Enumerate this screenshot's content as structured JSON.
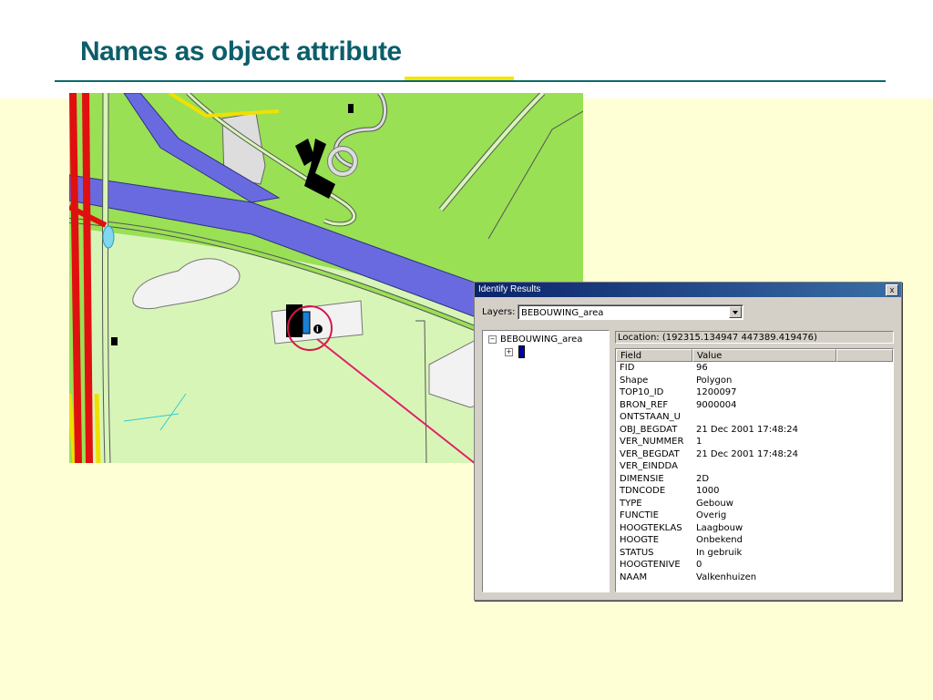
{
  "slide": {
    "title": "Names as object attribute"
  },
  "colors": {
    "title": "#0b5e6a",
    "accent": "#f5e700",
    "background": "#ffffd6",
    "highlight_circle": "#d6164a"
  },
  "dialog": {
    "title": "Identify Results",
    "close_label": "x",
    "layers_label": "Layers:",
    "layers_value": "BEBOUWING_area",
    "tree": {
      "root_label": "BEBOUWING_area",
      "root_toggle": "−",
      "child_toggle": "+"
    },
    "location": "Location: (192315.134947  447389.419476)",
    "columns": {
      "field": "Field",
      "value": "Value",
      "extra": ""
    },
    "rows": [
      {
        "field": "FID",
        "value": "96"
      },
      {
        "field": "Shape",
        "value": "Polygon"
      },
      {
        "field": "TOP10_ID",
        "value": "1200097"
      },
      {
        "field": "BRON_REF",
        "value": "9000004"
      },
      {
        "field": "ONTSTAAN_U",
        "value": ""
      },
      {
        "field": "OBJ_BEGDAT",
        "value": "21 Dec 2001 17:48:24"
      },
      {
        "field": "VER_NUMMER",
        "value": "1"
      },
      {
        "field": "VER_BEGDAT",
        "value": "21 Dec 2001 17:48:24"
      },
      {
        "field": "VER_EINDDA",
        "value": ""
      },
      {
        "field": "DIMENSIE",
        "value": "2D"
      },
      {
        "field": "TDNCODE",
        "value": "1000"
      },
      {
        "field": "TYPE",
        "value": "Gebouw"
      },
      {
        "field": "FUNCTIE",
        "value": "Overig"
      },
      {
        "field": "HOOGTEKLAS",
        "value": "Laagbouw"
      },
      {
        "field": "HOOGTE",
        "value": "Onbekend"
      },
      {
        "field": "STATUS",
        "value": "In gebruik"
      },
      {
        "field": "HOOGTENIVE",
        "value": "0"
      },
      {
        "field": "NAAM",
        "value": "Valkenhuizen"
      }
    ]
  }
}
